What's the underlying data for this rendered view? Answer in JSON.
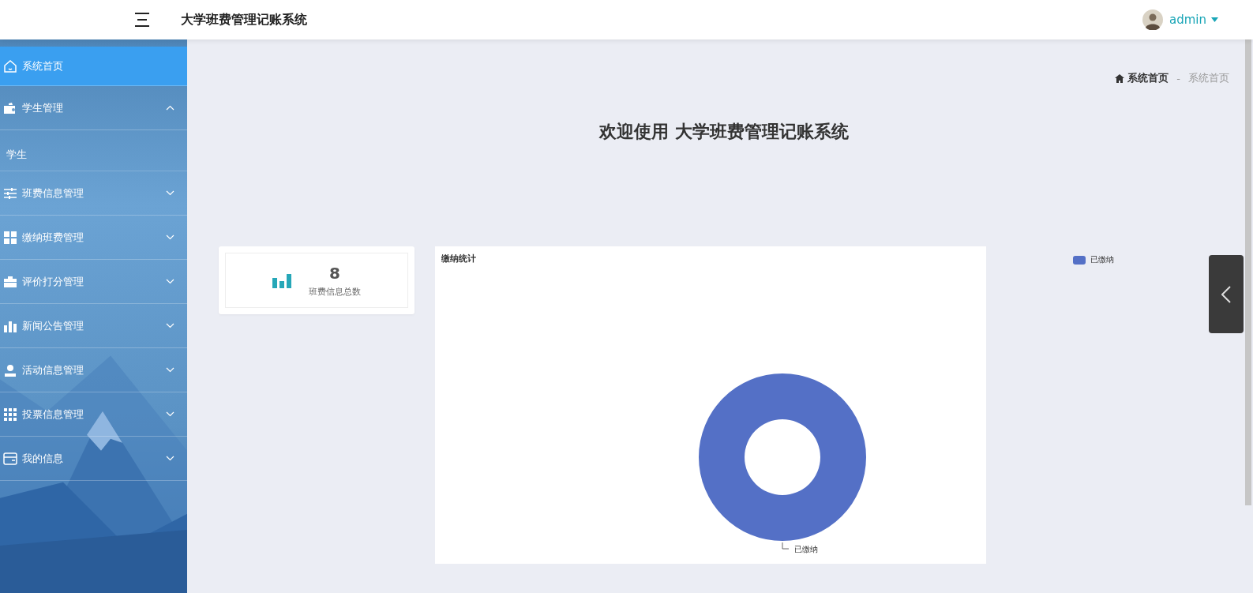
{
  "header": {
    "title": "大学班费管理记账系统",
    "user": {
      "name": "admin"
    }
  },
  "sidebar": {
    "items": [
      {
        "label": "系统首页",
        "selected": true
      },
      {
        "label": "学生管理",
        "selected": false,
        "expanded": true,
        "children": [
          {
            "label": "学生",
            "selected": false
          }
        ]
      },
      {
        "label": "班费信息管理",
        "selected": false,
        "expanded": false
      },
      {
        "label": "缴纳班费管理",
        "selected": false,
        "expanded": false
      },
      {
        "label": "评价打分管理",
        "selected": false,
        "expanded": false
      },
      {
        "label": "新闻公告管理",
        "selected": false,
        "expanded": false
      },
      {
        "label": "活动信息管理",
        "selected": false,
        "expanded": false
      },
      {
        "label": "投票信息管理",
        "selected": false,
        "expanded": false
      },
      {
        "label": "我的信息",
        "selected": false,
        "expanded": false
      }
    ]
  },
  "breadcrumb": [
    "系统首页",
    "-",
    "系统首页"
  ],
  "welcome": "欢迎使用 大学班费管理记账系统",
  "stat_card": {
    "value": "8",
    "label": "班费信息总数"
  },
  "chart_card": {
    "title": "缴纳统计",
    "kind": "donut",
    "segments": [
      {
        "label": "已缴纳",
        "color": "#5470c6"
      }
    ],
    "legend": [
      {
        "label": "已缴纳",
        "color": "#5470c6"
      }
    ]
  }
}
